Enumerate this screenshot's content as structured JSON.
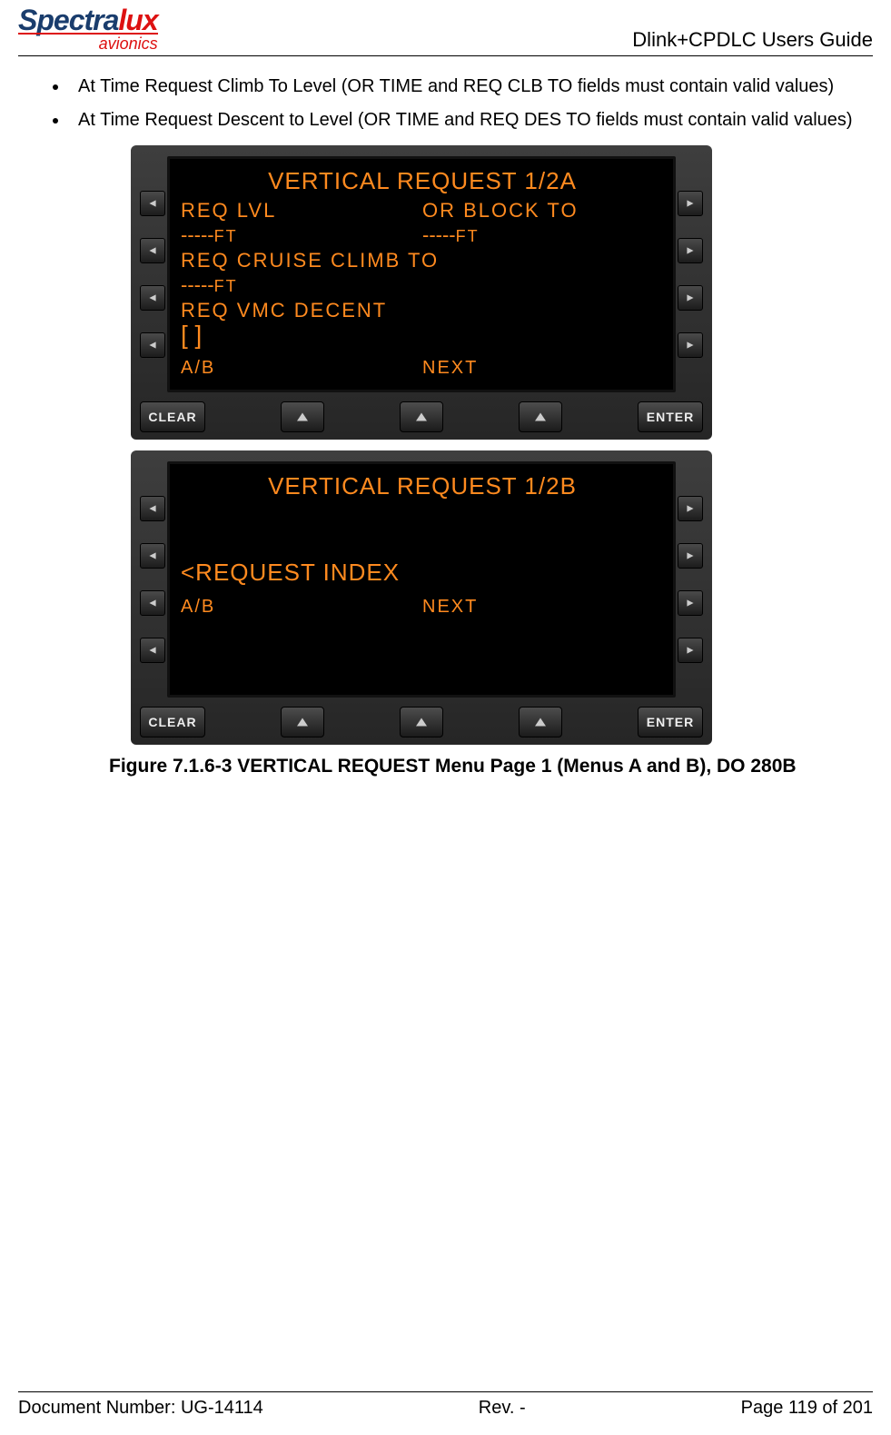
{
  "header": {
    "logo_main": "Spectralux",
    "logo_sub": "avionics",
    "doc_title": "Dlink+CPDLC Users Guide"
  },
  "bullets": [
    "At Time Request Climb To Level (OR TIME and REQ CLB TO fields must contain valid values)",
    "At Time Request Descent to Level (OR TIME and REQ DES TO fields must contain valid values)"
  ],
  "screen_a": {
    "title": "VERTICAL REQUEST 1/2A",
    "l1a": "REQ LVL",
    "l1b": "OR BLOCK TO",
    "l2a_dash": "-----",
    "l2a_ft": "FT",
    "l2b_dash": "-----",
    "l2b_ft": "FT",
    "l3": "REQ CRUISE CLIMB TO",
    "l4_dash": "-----",
    "l4_ft": "FT",
    "l5": "REQ VMC DECENT",
    "l6": "[    ]",
    "foot_left": "A/B",
    "foot_right": "NEXT"
  },
  "screen_b": {
    "title": "VERTICAL REQUEST 1/2B",
    "reqidx": "<REQUEST INDEX",
    "foot_left": "A/B",
    "foot_right": "NEXT"
  },
  "buttons": {
    "clear": "CLEAR",
    "enter": "ENTER"
  },
  "caption": "Figure 7.1.6-3 VERTICAL REQUEST Menu Page 1 (Menus A and B), DO 280B",
  "footer": {
    "left": "Document Number:  UG-14114",
    "center": "Rev. -",
    "right": "Page 119 of 201"
  }
}
